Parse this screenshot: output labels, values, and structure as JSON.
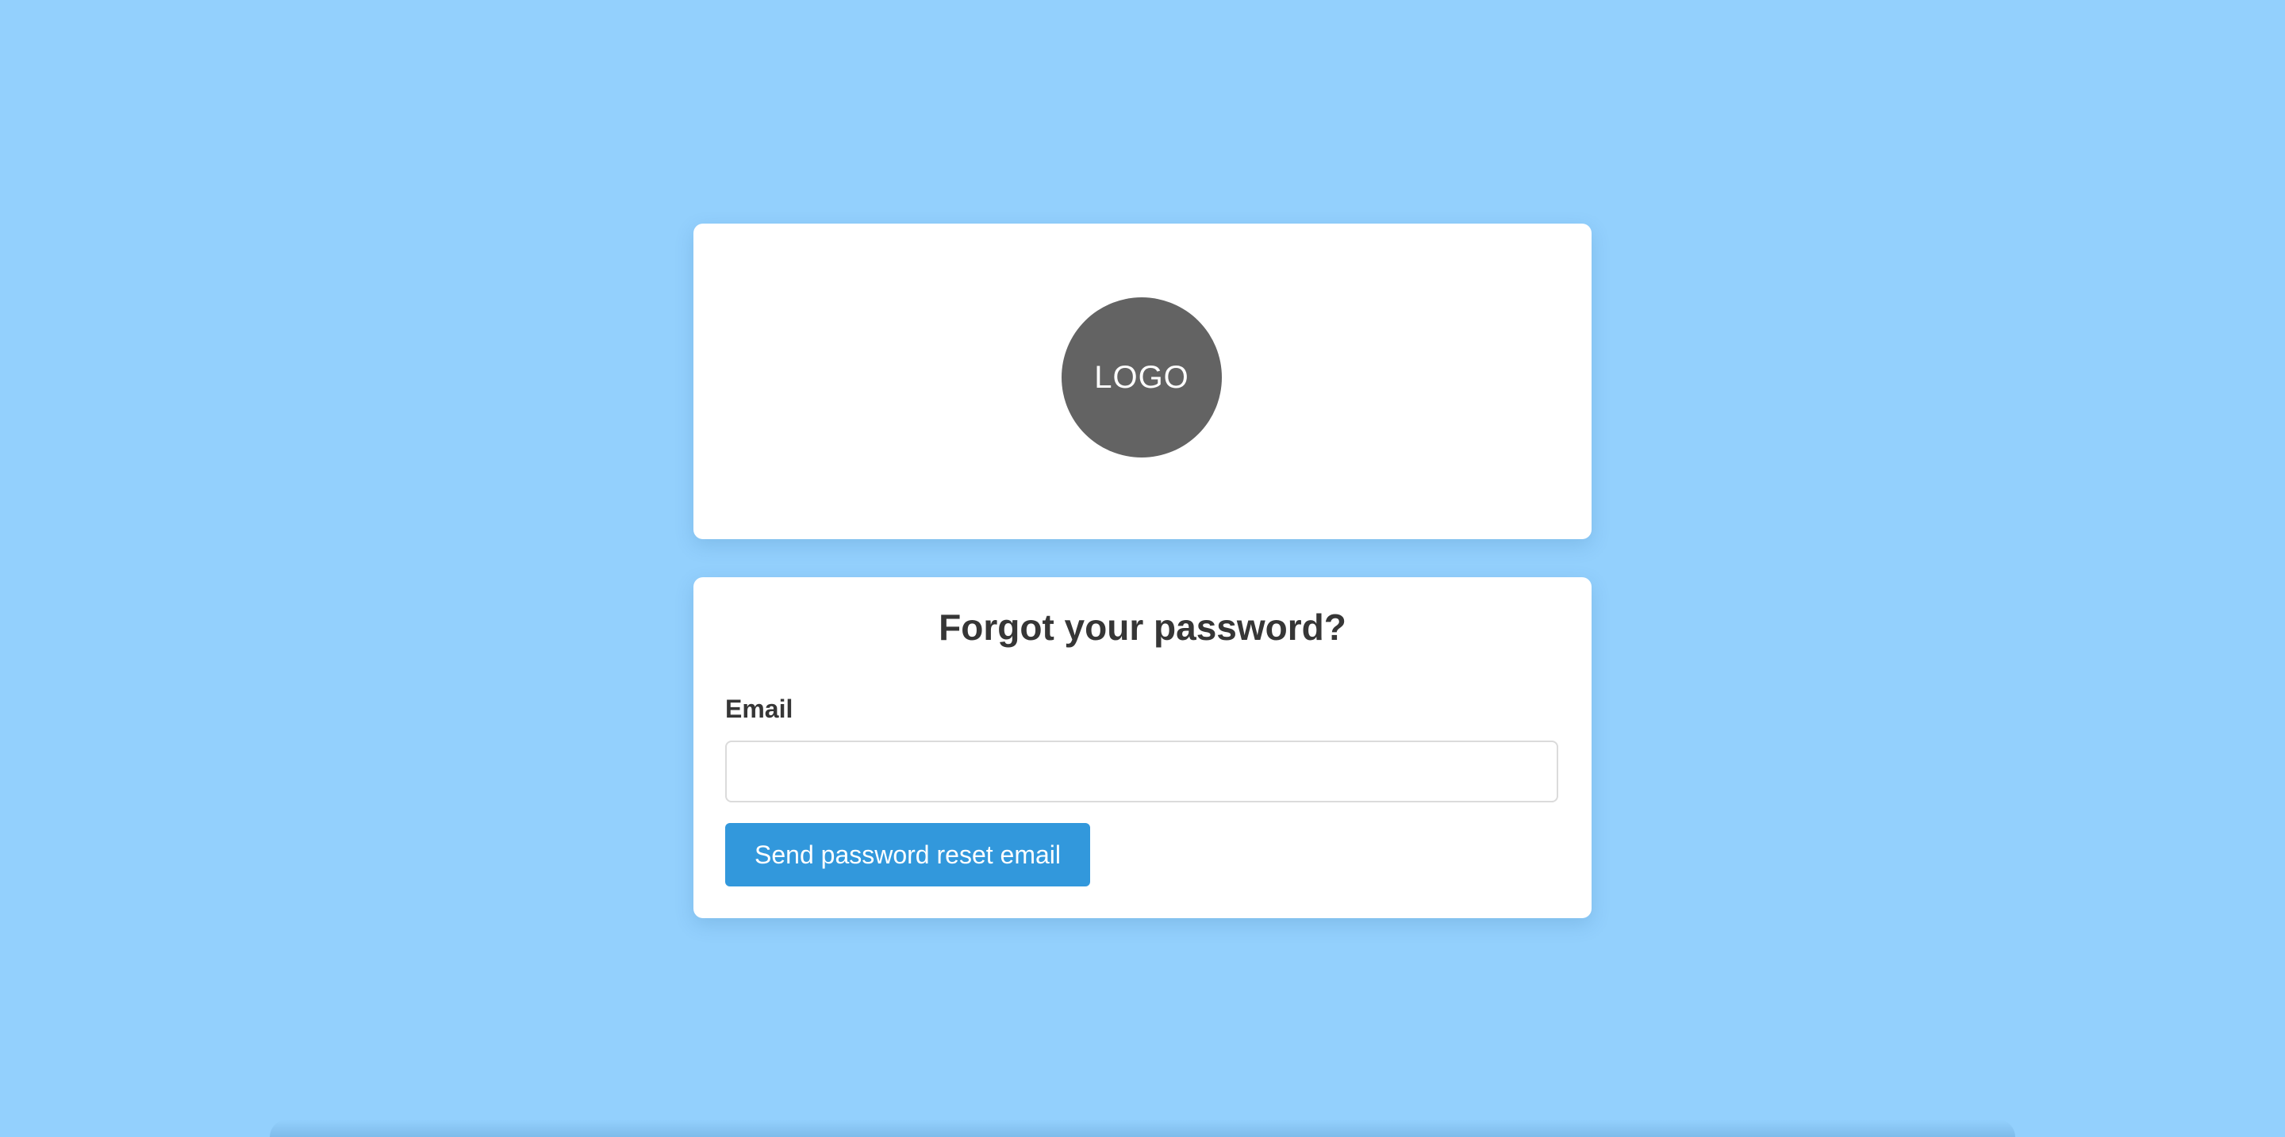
{
  "logo_card": {
    "logo_text": "LOGO"
  },
  "form": {
    "title": "Forgot your password?",
    "email_label": "Email",
    "email_value": "",
    "email_placeholder": "",
    "submit_label": "Send password reset email"
  },
  "colors": {
    "background": "#93d0fd",
    "card": "#ffffff",
    "logo_circle": "#636363",
    "button": "#3298dc",
    "text": "#363636"
  }
}
